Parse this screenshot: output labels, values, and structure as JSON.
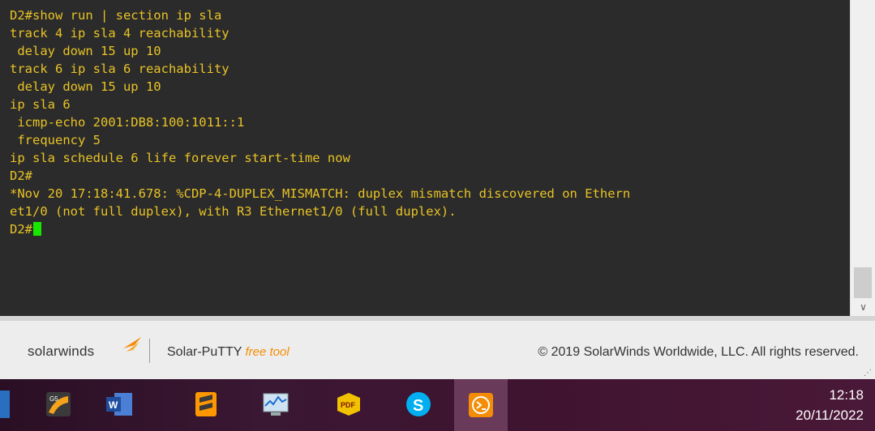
{
  "terminal": {
    "lines": [
      "D2#show run | section ip sla",
      "track 4 ip sla 4 reachability",
      " delay down 15 up 10",
      "track 6 ip sla 6 reachability",
      " delay down 15 up 10",
      "ip sla 6",
      " icmp-echo 2001:DB8:100:1011::1",
      " frequency 5",
      "ip sla schedule 6 life forever start-time now",
      "D2#",
      "*Nov 20 17:18:41.678: %CDP-4-DUPLEX_MISMATCH: duplex mismatch discovered on Ethern",
      "et1/0 (not full duplex), with R3 Ethernet1/0 (full duplex).",
      "D2#"
    ],
    "text_color": "#e8c326",
    "cursor_color": "#19e600"
  },
  "footer": {
    "brand": "solarwinds",
    "product": "Solar-PuTTY",
    "product_tag": "free tool",
    "copyright": "© 2019 SolarWinds Worldwide, LLC. All rights reserved."
  },
  "taskbar": {
    "apps": [
      {
        "name": "gns3-icon"
      },
      {
        "name": "word-icon"
      },
      {
        "name": "sublime-text-icon"
      },
      {
        "name": "performance-monitor-icon"
      },
      {
        "name": "pdf-reader-icon"
      },
      {
        "name": "skype-icon"
      },
      {
        "name": "solar-putty-icon"
      }
    ],
    "time": "12:18",
    "date": "20/11/2022"
  }
}
